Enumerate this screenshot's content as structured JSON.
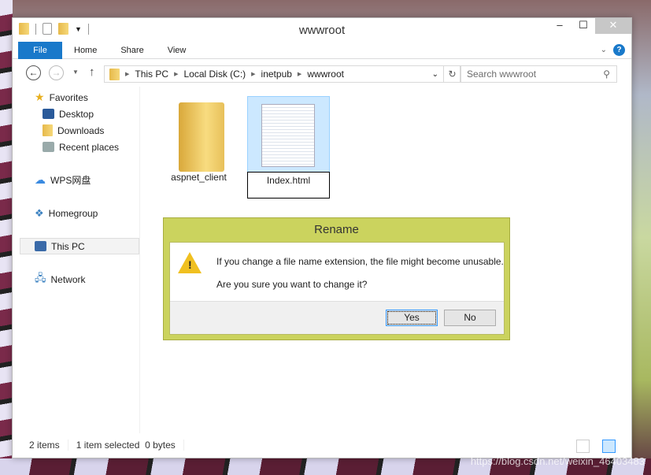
{
  "window": {
    "title": "wwwroot",
    "min": "–",
    "max": "☐",
    "close": "✕"
  },
  "ribbon": {
    "tabs": [
      "File",
      "Home",
      "Share",
      "View"
    ]
  },
  "nav": {
    "back": "←",
    "forward": "→",
    "up": "↑",
    "crumbs": [
      "This PC",
      "Local Disk (C:)",
      "inetpub",
      "wwwroot"
    ],
    "search_placeholder": "Search wwwroot"
  },
  "sidebar": {
    "items": [
      {
        "label": "Favorites"
      },
      {
        "label": "Desktop"
      },
      {
        "label": "Downloads"
      },
      {
        "label": "Recent places"
      },
      {
        "label": "WPS网盘"
      },
      {
        "label": "Homegroup"
      },
      {
        "label": "This PC"
      },
      {
        "label": "Network"
      }
    ]
  },
  "files": [
    {
      "name": "aspnet_client",
      "type": "folder"
    },
    {
      "name": "Index.html",
      "type": "document",
      "selected": true
    }
  ],
  "status": {
    "count": "2 items",
    "selected": "1 item selected  0 bytes"
  },
  "dialog": {
    "title": "Rename",
    "line1": "If you change a file name extension, the file might become unusable.",
    "line2": "Are you sure you want to change it?",
    "yes": "Yes",
    "no": "No",
    "accent": "#cbd35e"
  },
  "watermark": "https://blog.csdn.net/weixin_46403483"
}
